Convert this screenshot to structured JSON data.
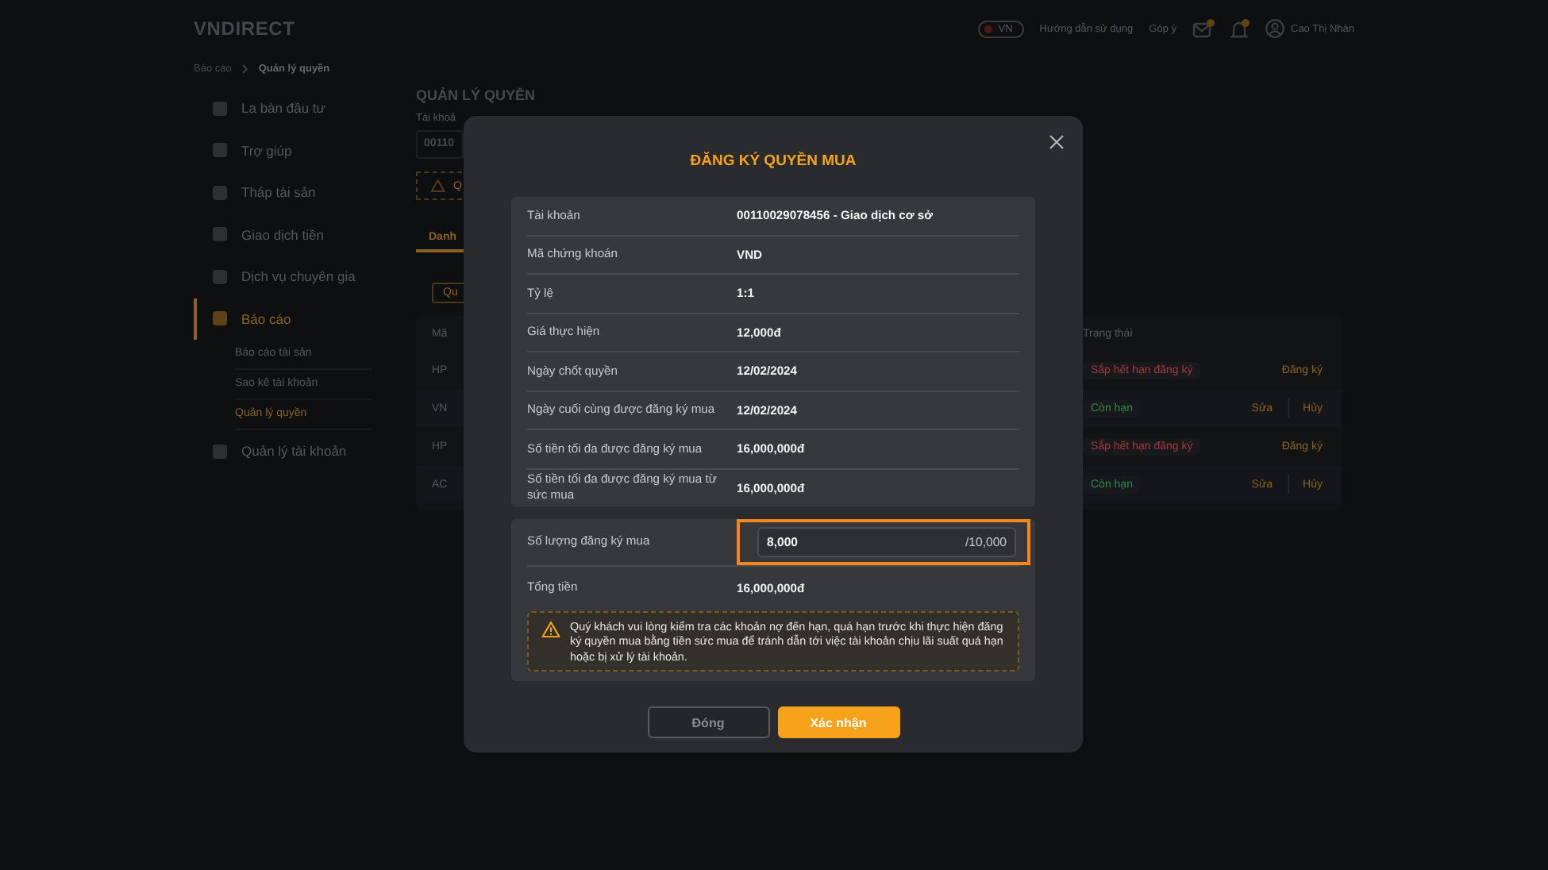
{
  "header": {
    "logo": "VNDIRECT",
    "language": "VN",
    "links": [
      "Hướng dẫn sử dụng",
      "Góp ý"
    ],
    "user": "Cao Thị Nhàn"
  },
  "breadcrumb": [
    {
      "label": "Báo cáo",
      "selected": false
    },
    {
      "label": "Quản lý quyền",
      "selected": true
    }
  ],
  "sidebar": {
    "items": [
      {
        "label": "La bàn đầu tư",
        "selected": false
      },
      {
        "label": "Trợ giúp",
        "selected": false
      },
      {
        "label": "Tháp tài sản",
        "selected": false
      },
      {
        "label": "Giao dịch tiền",
        "selected": false
      },
      {
        "label": "Dịch vụ chuyên gia",
        "selected": false
      },
      {
        "label": "Báo cáo",
        "selected": true,
        "children": [
          {
            "label": "Báo cáo tài sản",
            "selected": false
          },
          {
            "label": "Sao kê tài khoản",
            "selected": false
          },
          {
            "label": "Quản lý quyền",
            "selected": true
          }
        ]
      },
      {
        "label": "Quản lý tài khoản",
        "selected": false
      }
    ]
  },
  "page": {
    "title": "QUẢN LÝ QUYỀN",
    "account_label": "Tài khoả",
    "account_value": "00110",
    "notice": "Q",
    "tab": "Danh",
    "filter_button": "Qu",
    "table": {
      "columns": [
        "Mã",
        "Trạng thái"
      ],
      "rows": [
        {
          "code": "HP",
          "status": "Sắp hết hạn đăng ký",
          "color": "#a33a3a",
          "actions": [
            "Đăng ký"
          ]
        },
        {
          "code": "VN",
          "status": "Còn hạn",
          "color": "#2f8a4c",
          "actions": [
            "Sửa",
            "Hủy"
          ]
        },
        {
          "code": "HP",
          "status": "Sắp hết hạn đăng ký",
          "color": "#a33a3a",
          "actions": [
            "Đăng ký"
          ]
        },
        {
          "code": "AC",
          "status": "Còn hạn",
          "color": "#2f8a4c",
          "actions": [
            "Sửa",
            "Hủy"
          ]
        }
      ]
    }
  },
  "dialog": {
    "title": "ĐĂNG KÝ QUYỀN MUA",
    "info_rows": [
      {
        "label": "Tài khoản",
        "value": "00110029078456 - Giao dịch cơ sở"
      },
      {
        "label": "Mã chứng khoán",
        "value": "VND"
      },
      {
        "label": "Tỷ lệ",
        "value": "1:1"
      },
      {
        "label": "Giá thực hiện",
        "value": "12,000đ"
      },
      {
        "label": "Ngày chốt quyền",
        "value": "12/02/2024"
      },
      {
        "label": "Ngày cuối cùng được đăng ký mua",
        "value": "12/02/2024"
      },
      {
        "label": "Số tiền tối đa được đăng ký mua",
        "value": "16,000,000đ"
      },
      {
        "label": "Số tiền tối đa được đăng ký mua từ sức mua",
        "value": "16,000,000đ"
      }
    ],
    "quantity": {
      "label": "Số lượng đăng ký mua",
      "value": "8,000",
      "max": "/10,000",
      "highlighted": true
    },
    "total": {
      "label": "Tổng tiền",
      "value": "16,000,000đ"
    },
    "warning": "Quý khách vui lòng kiểm tra các khoản nợ đến hạn, quá hạn trước khi thực hiện đăng ký quyền mua bằng tiền sức mua để tránh dẫn tới việc tài khoản chịu lãi suất quá hạn hoặc bị xử lý tài khoản.",
    "buttons": [
      {
        "label": "Đóng",
        "kind": "secondary"
      },
      {
        "label": "Xác nhận",
        "kind": "primary"
      }
    ]
  }
}
